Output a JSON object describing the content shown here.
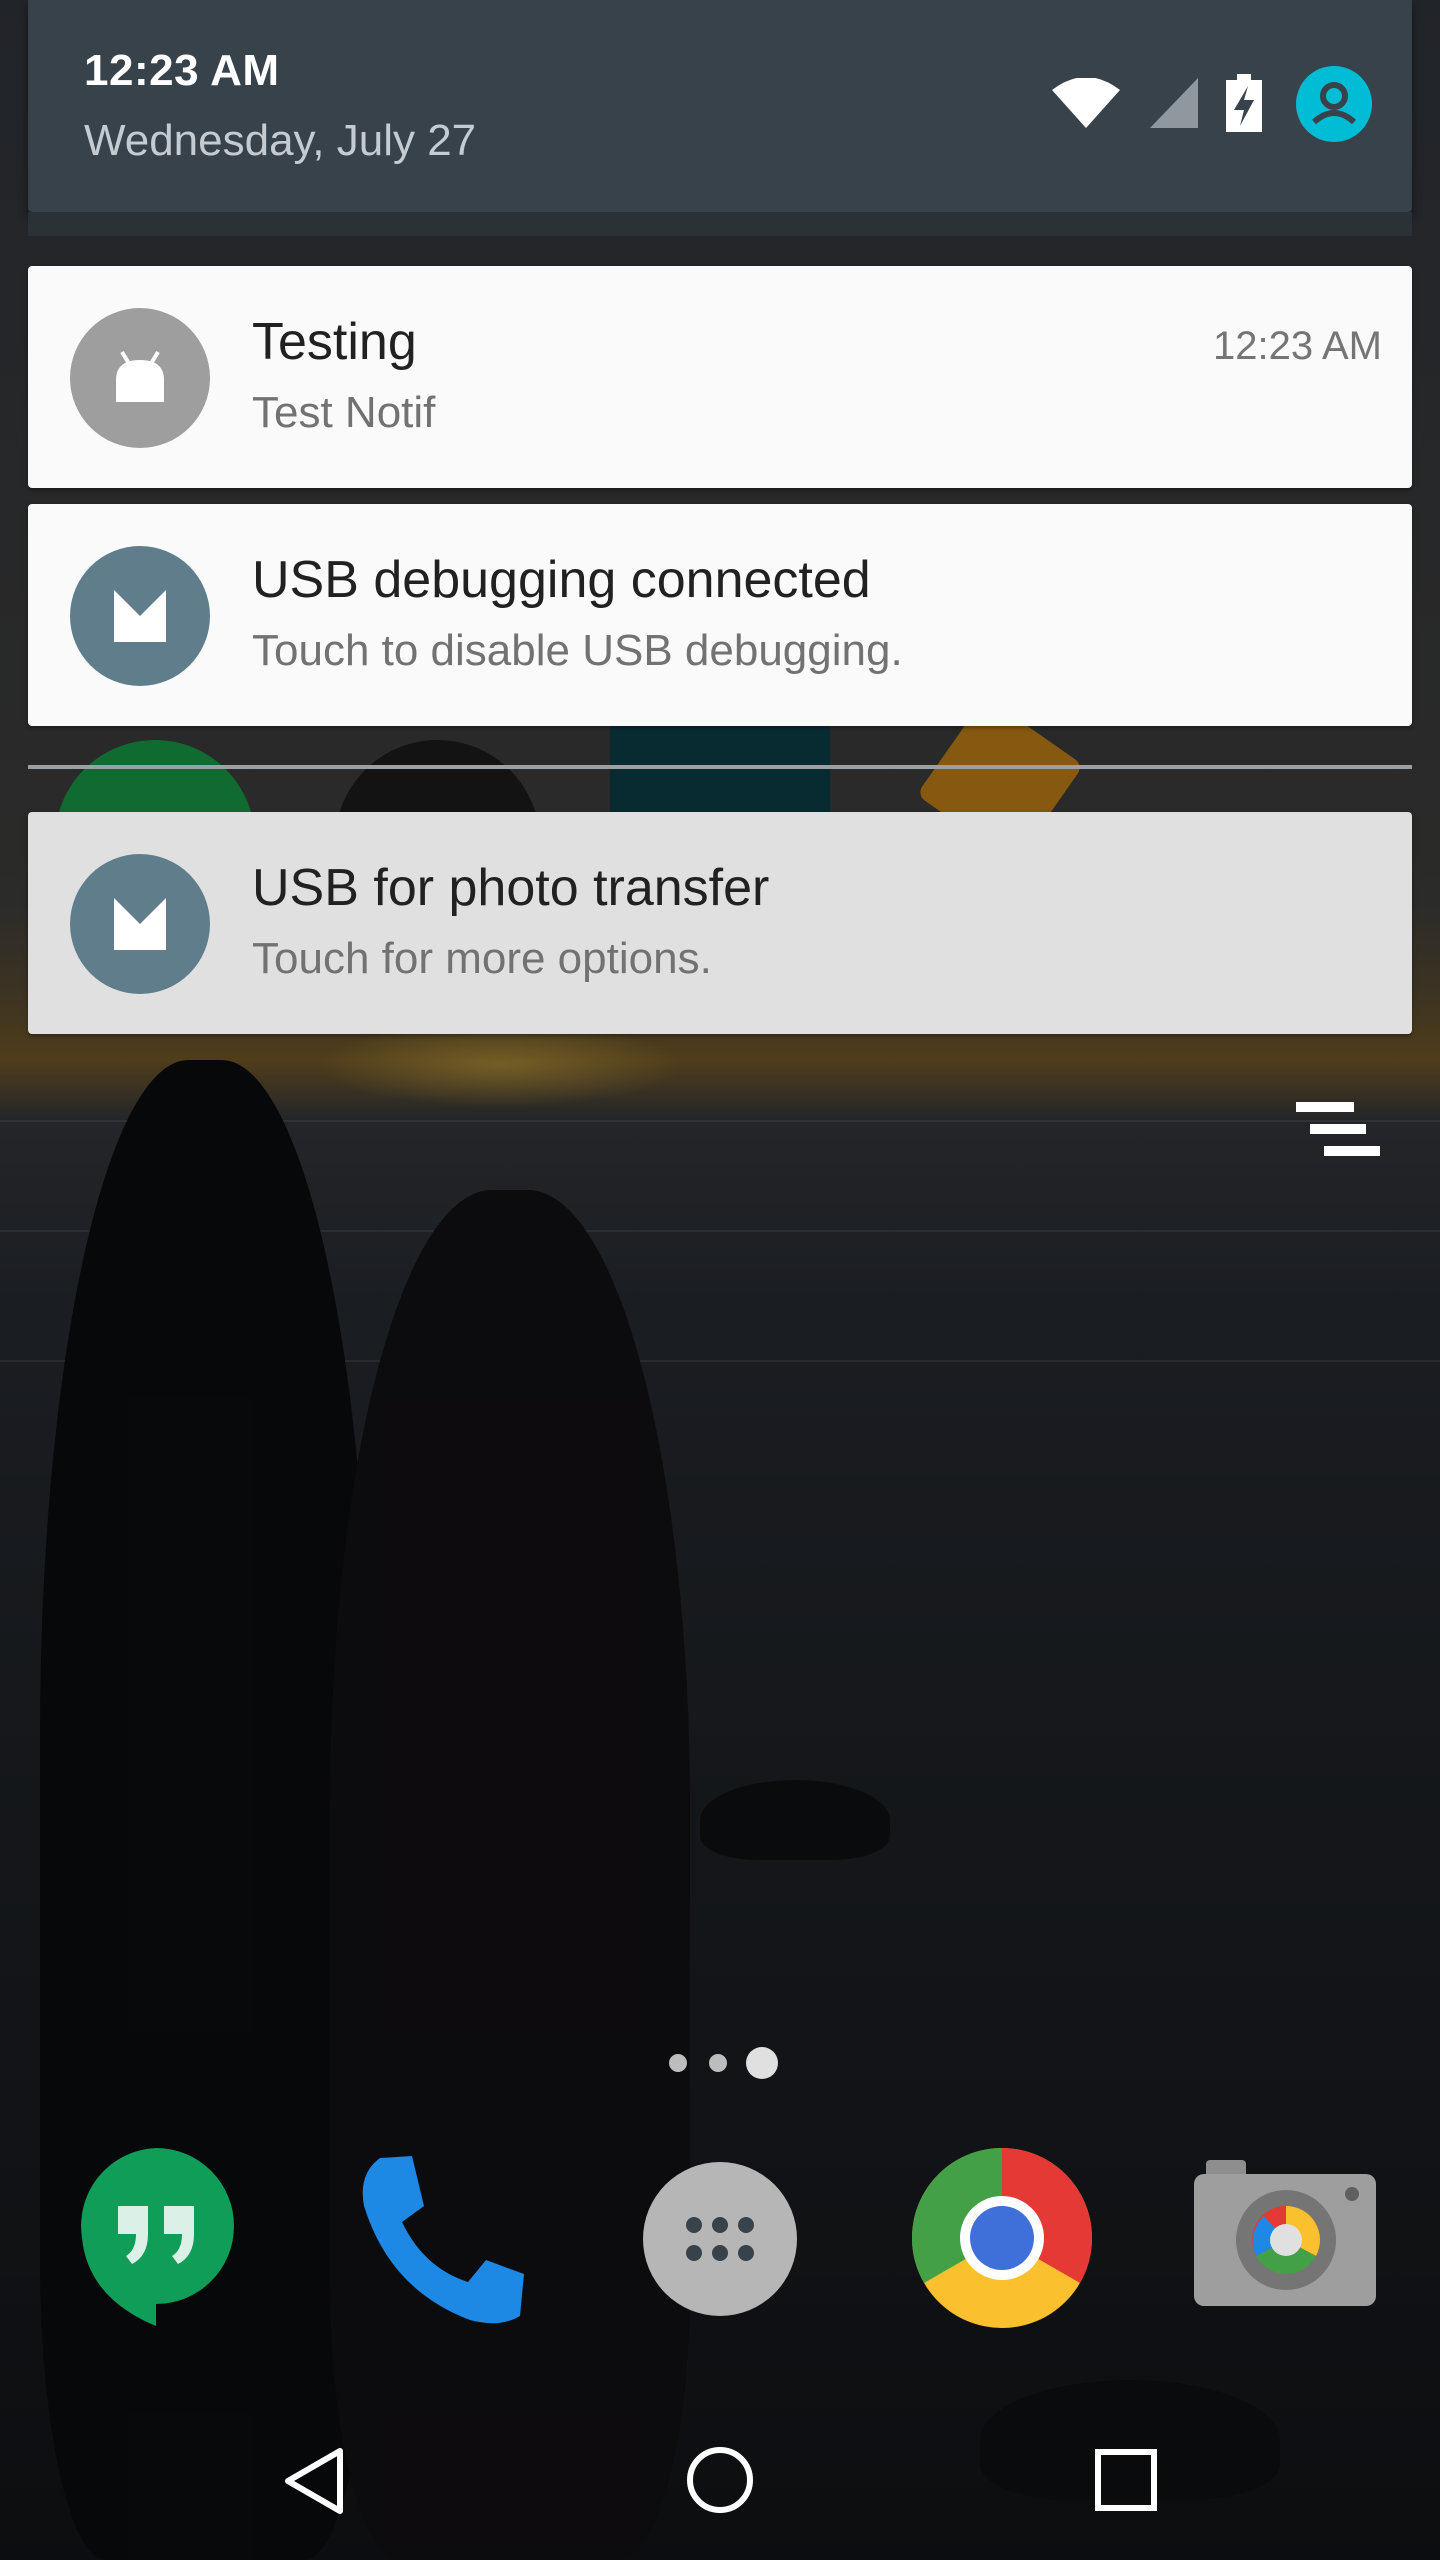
{
  "status": {
    "time": "12:23 AM",
    "date": "Wednesday, July 27",
    "icons": [
      "wifi-icon",
      "cell-signal-icon",
      "battery-charging-icon",
      "user-avatar-icon"
    ]
  },
  "notifications": [
    {
      "app_icon": "android-icon",
      "title": "Testing",
      "text": "Test Notif",
      "time": "12:23 AM",
      "icon_color": "#9e9e9e"
    },
    {
      "app_icon": "android-bug-icon",
      "title": "USB debugging connected",
      "text": "Touch to disable USB debugging.",
      "icon_color": "#607d8b"
    },
    {
      "app_icon": "android-usb-icon",
      "title": "USB for photo transfer",
      "text": "Touch for more options.",
      "icon_color": "#607d8b"
    }
  ],
  "shade": {
    "clear_all_icon": "clear-all-icon"
  },
  "home": {
    "pages": 3,
    "current_page": 3,
    "dock": [
      "hangouts-icon",
      "phone-icon",
      "app-drawer-icon",
      "chrome-icon",
      "camera-icon"
    ]
  },
  "nav": [
    "back-icon",
    "home-icon",
    "recents-icon"
  ],
  "colors": {
    "shade_header": "#37424a",
    "accent_avatar": "#00bcd4",
    "card_bg": "#fafafa",
    "card_dim_bg": "#e0e0e0"
  }
}
